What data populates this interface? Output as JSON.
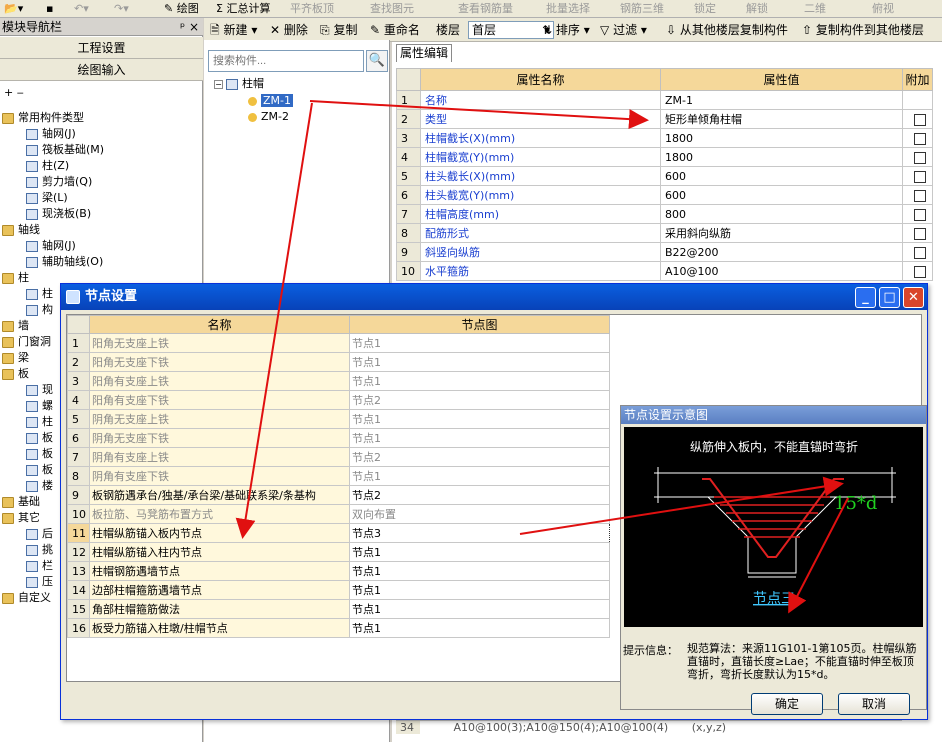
{
  "topbar": {
    "items": [
      "绘图",
      "Σ 汇总计算",
      "平齐板顶",
      "查找图元",
      "查看钢筋量",
      "批量选择",
      "钢筋三维",
      "锁定",
      "解锁",
      "二维",
      "俯视"
    ]
  },
  "left_panel": {
    "title": "模块导航栏",
    "pin": "ᵖ ×",
    "buttons": [
      "工程设置",
      "绘图输入"
    ],
    "tree": [
      {
        "label": "常用构件类型",
        "level": 0,
        "type": "folder"
      },
      {
        "label": "轴网(J)",
        "level": 1,
        "type": "comp"
      },
      {
        "label": "筏板基础(M)",
        "level": 1,
        "type": "comp"
      },
      {
        "label": "柱(Z)",
        "level": 1,
        "type": "comp"
      },
      {
        "label": "剪力墙(Q)",
        "level": 1,
        "type": "comp"
      },
      {
        "label": "梁(L)",
        "level": 1,
        "type": "comp"
      },
      {
        "label": "现浇板(B)",
        "level": 1,
        "type": "comp"
      },
      {
        "label": "轴线",
        "level": 0,
        "type": "folder"
      },
      {
        "label": "轴网(J)",
        "level": 1,
        "type": "comp"
      },
      {
        "label": "辅助轴线(O)",
        "level": 1,
        "type": "comp"
      },
      {
        "label": "柱",
        "level": 0,
        "type": "folder"
      },
      {
        "label": "柱",
        "level": 1,
        "type": "comp"
      },
      {
        "label": "构",
        "level": 1,
        "type": "comp"
      },
      {
        "label": "墙",
        "level": 0,
        "type": "folder"
      },
      {
        "label": "门窗洞",
        "level": 0,
        "type": "folder"
      },
      {
        "label": "梁",
        "level": 0,
        "type": "folder"
      },
      {
        "label": "板",
        "level": 0,
        "type": "folder"
      },
      {
        "label": "现",
        "level": 1,
        "type": "comp"
      },
      {
        "label": "螺",
        "level": 1,
        "type": "comp"
      },
      {
        "label": "柱",
        "level": 1,
        "type": "comp"
      },
      {
        "label": "板",
        "level": 1,
        "type": "comp"
      },
      {
        "label": "板",
        "level": 1,
        "type": "comp"
      },
      {
        "label": "板",
        "level": 1,
        "type": "comp"
      },
      {
        "label": "楼",
        "level": 1,
        "type": "comp"
      },
      {
        "label": "基础",
        "level": 0,
        "type": "folder"
      },
      {
        "label": "其它",
        "level": 0,
        "type": "folder"
      },
      {
        "label": "后",
        "level": 1,
        "type": "comp"
      },
      {
        "label": "挑",
        "level": 1,
        "type": "comp"
      },
      {
        "label": "栏",
        "level": 1,
        "type": "comp"
      },
      {
        "label": "压",
        "level": 1,
        "type": "comp"
      },
      {
        "label": "自定义",
        "level": 0,
        "type": "folder"
      }
    ]
  },
  "toolbar2": {
    "new": "新建",
    "delete": "删除",
    "copy": "复制",
    "rename": "重命名",
    "floor_label": "楼层",
    "floor_value": "首层",
    "sort": "排序",
    "filter": "过滤",
    "copy_from": "从其他楼层复制构件",
    "copy_to": "复制构件到其他楼层"
  },
  "mid_panel": {
    "search_placeholder": "搜索构件...",
    "search_icon": "🔍",
    "root": "柱帽",
    "items": [
      "ZM-1",
      "ZM-2"
    ]
  },
  "prop_panel": {
    "tab": "属性编辑",
    "headers": [
      "属性名称",
      "属性值",
      "附加"
    ],
    "rows": [
      {
        "no": "1",
        "name": "名称",
        "value": "ZM-1",
        "chk": false
      },
      {
        "no": "2",
        "name": "类型",
        "value": "矩形单倾角柱帽",
        "chk": true
      },
      {
        "no": "3",
        "name": "柱帽截长(X)(mm)",
        "value": "1800",
        "chk": true
      },
      {
        "no": "4",
        "name": "柱帽截宽(Y)(mm)",
        "value": "1800",
        "chk": true
      },
      {
        "no": "5",
        "name": "柱头截长(X)(mm)",
        "value": "600",
        "chk": true
      },
      {
        "no": "6",
        "name": "柱头截宽(Y)(mm)",
        "value": "600",
        "chk": true
      },
      {
        "no": "7",
        "name": "柱帽高度(mm)",
        "value": "800",
        "chk": true
      },
      {
        "no": "8",
        "name": "配筋形式",
        "value": "采用斜向纵筋",
        "chk": true
      },
      {
        "no": "9",
        "name": "斜竖向纵筋",
        "value": "B22@200",
        "chk": true
      },
      {
        "no": "10",
        "name": "水平箍筋",
        "value": "A10@100",
        "chk": true
      }
    ]
  },
  "dialog": {
    "title": "节点设置",
    "headers": [
      "名称",
      "节点图"
    ],
    "rows": [
      {
        "no": "1",
        "name": "阳角无支座上铁",
        "value": "节点1",
        "gray": true
      },
      {
        "no": "2",
        "name": "阳角无支座下铁",
        "value": "节点1",
        "gray": true
      },
      {
        "no": "3",
        "name": "阳角有支座上铁",
        "value": "节点1",
        "gray": true
      },
      {
        "no": "4",
        "name": "阳角有支座下铁",
        "value": "节点2",
        "gray": true
      },
      {
        "no": "5",
        "name": "阴角无支座上铁",
        "value": "节点1",
        "gray": true
      },
      {
        "no": "6",
        "name": "阴角无支座下铁",
        "value": "节点1",
        "gray": true
      },
      {
        "no": "7",
        "name": "阴角有支座上铁",
        "value": "节点2",
        "gray": true
      },
      {
        "no": "8",
        "name": "阴角有支座下铁",
        "value": "节点1",
        "gray": true
      },
      {
        "no": "9",
        "name": "板钢筋遇承台/独基/承台梁/基础联系梁/条基构",
        "value": "节点2",
        "gray": false
      },
      {
        "no": "10",
        "name": "板拉筋、马凳筋布置方式",
        "value": "双向布置",
        "gray": true
      },
      {
        "no": "11",
        "name": "柱帽纵筋锚入板内节点",
        "value": "节点3",
        "gray": false,
        "selected": true
      },
      {
        "no": "12",
        "name": "柱帽纵筋锚入柱内节点",
        "value": "节点1",
        "gray": false
      },
      {
        "no": "13",
        "name": "柱帽钢筋遇墙节点",
        "value": "节点1",
        "gray": false
      },
      {
        "no": "14",
        "name": "边部柱帽箍筋遇墙节点",
        "value": "节点1",
        "gray": false
      },
      {
        "no": "15",
        "name": "角部柱帽箍筋做法",
        "value": "节点1",
        "gray": false
      },
      {
        "no": "16",
        "name": "板受力筋锚入柱墩/柱帽节点",
        "value": "节点1",
        "gray": false
      }
    ],
    "preview": {
      "title": "节点设置示意图",
      "caption_top": "纵筋伸入板内，不能直锚时弯折",
      "annotation": "15*d",
      "node_label": "节点三",
      "hint_label": "提示信息：",
      "hint_text": "规范算法：来源11G101-1第105页。柱帽纵筋直锚时，直锚长度≥Lae；不能直锚时伸至板顶弯折，弯折长度默认为15*d。"
    },
    "ok": "确定",
    "cancel": "取消",
    "min": "_",
    "max": "□",
    "close": "✕"
  },
  "bottom_row_partial": "A10@100(3);A10@150(4);A10@100(4)",
  "bottom_row_num": "34",
  "bottom_row_val": "(x,y,z)"
}
